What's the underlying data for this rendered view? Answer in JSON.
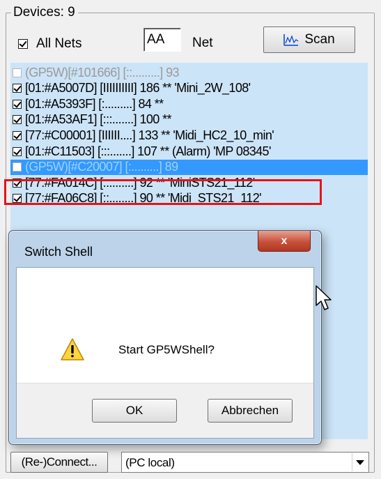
{
  "devices": {
    "title": "Devices: 9"
  },
  "filters": {
    "all_nets_label": "All Nets",
    "net_value": "AA",
    "net_label": "Net",
    "scan_label": "Scan"
  },
  "list": {
    "rows": [
      {
        "text": "(GP5W)[#101666] [::.........] 93",
        "checked": false,
        "state": "dim"
      },
      {
        "text": "[01:#A5007D] [IIIIIIIIII] 186 ** 'Mini_2W_108'",
        "checked": true,
        "state": "normal"
      },
      {
        "text": "[01:#A5393F] [:.........] 84 **",
        "checked": true,
        "state": "normal"
      },
      {
        "text": "[01:#A53AF1] [:::.......] 100 **",
        "checked": true,
        "state": "normal"
      },
      {
        "text": "[77:#C00001] [IIIIII....] 133 ** 'Midi_HC2_10_min'",
        "checked": true,
        "state": "normal"
      },
      {
        "text": "[01:#C11503] [:::.......] 107 ** (Alarm) 'MP 08345'",
        "checked": true,
        "state": "normal"
      },
      {
        "text": "(GP5W)[#C20007] [:.........] 89",
        "checked": false,
        "state": "selected"
      },
      {
        "text": "[77:#FA014C] [:.........] 92 ** 'MiniSTS21_112'",
        "checked": true,
        "state": "normal"
      },
      {
        "text": "[77:#FA06C8] [::........] 90 ** 'Midi_STS21_112'",
        "checked": true,
        "state": "normal"
      }
    ]
  },
  "dialog": {
    "title": "Switch Shell",
    "close_glyph": "x",
    "message": "Start GP5WShell?",
    "ok_label": "OK",
    "cancel_label": "Abbrechen",
    "icon": "warning-icon"
  },
  "bottom": {
    "connect_label": "(Re-)Connect...",
    "connection_value": "(PC local)"
  },
  "colors": {
    "list_bg": "#cce4f7",
    "selection": "#3399ff",
    "highlight_box": "#e3141a"
  }
}
